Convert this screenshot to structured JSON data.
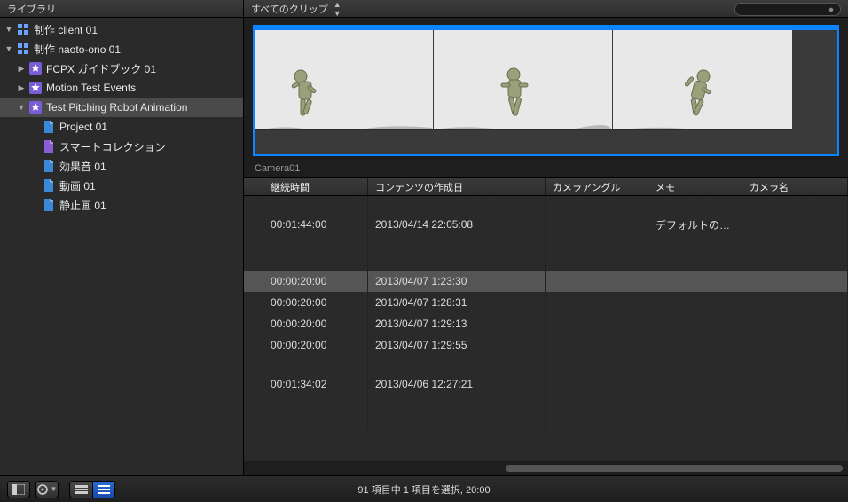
{
  "sidebar": {
    "title": "ライブラリ",
    "items": [
      {
        "label": "制作 client 01",
        "type": "library",
        "depth": 0,
        "expanded": true
      },
      {
        "label": "制作 naoto-ono 01",
        "type": "library",
        "depth": 0,
        "expanded": true
      },
      {
        "label": "FCPX ガイドブック 01",
        "type": "event",
        "depth": 1,
        "expanded": false
      },
      {
        "label": "Motion Test Events",
        "type": "event",
        "depth": 1,
        "expanded": false
      },
      {
        "label": "Test Pitching Robot Animation",
        "type": "event",
        "depth": 1,
        "expanded": true,
        "selected": true
      },
      {
        "label": "Project 01",
        "type": "project",
        "depth": 2
      },
      {
        "label": "スマートコレクション",
        "type": "smart",
        "depth": 2
      },
      {
        "label": "効果音 01",
        "type": "keyword",
        "depth": 2
      },
      {
        "label": "動画 01",
        "type": "keyword",
        "depth": 2
      },
      {
        "label": "静止画 01",
        "type": "keyword",
        "depth": 2
      }
    ]
  },
  "main": {
    "filter_label": "すべてのクリップ",
    "search_placeholder": "",
    "clip_name": "Camera01",
    "columns": {
      "duration": "継続時間",
      "created": "コンテンツの作成日",
      "angle": "カメラアングル",
      "memo": "メモ",
      "camname": "カメラ名"
    },
    "rows": [
      {
        "gap": true
      },
      {
        "duration": "00:01:44:00",
        "created": "2013/04/14 22:05:08",
        "memo": "デフォルトの…"
      },
      {
        "gap": true
      },
      {
        "gap": true
      },
      {
        "duration": "00:00:20:00",
        "created": "2013/04/07 1:23:30",
        "selected": true
      },
      {
        "duration": "00:00:20:00",
        "created": "2013/04/07 1:28:31"
      },
      {
        "duration": "00:00:20:00",
        "created": "2013/04/07 1:29:13"
      },
      {
        "duration": "00:00:20:00",
        "created": "2013/04/07 1:29:55"
      },
      {
        "gap": true
      },
      {
        "duration": "00:01:34:02",
        "created": "2013/04/06 12:27:21"
      },
      {
        "gap": true
      },
      {
        "gap": true
      }
    ]
  },
  "footer": {
    "status": "91 項目中 1 項目を選択, 20:00"
  }
}
